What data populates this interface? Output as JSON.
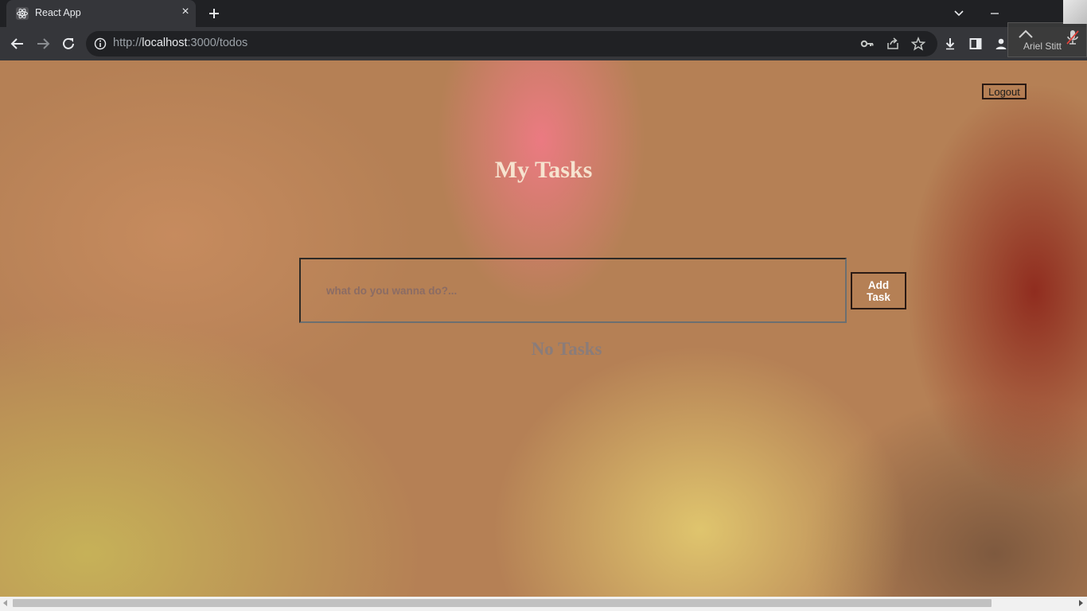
{
  "browser": {
    "tab": {
      "title": "React App",
      "close_glyph": "×"
    },
    "url": {
      "scheme": "http://",
      "host": "localhost",
      "rest": ":3000/todos"
    },
    "icons": [
      "react-favicon-icon",
      "close-icon",
      "plus-icon",
      "chevron-down-icon",
      "minimize-icon",
      "back-arrow-icon",
      "forward-arrow-icon",
      "reload-icon",
      "info-icon",
      "key-icon",
      "share-icon",
      "star-icon",
      "download-icon",
      "side-panel-icon",
      "profile-icon"
    ]
  },
  "meeting": {
    "participant_name": "Ariel Stitt"
  },
  "page": {
    "logout_label": "Logout",
    "title": "My Tasks",
    "input_placeholder": "what do you wanna do?...",
    "add_task_label": "Add Task",
    "empty_message": "No Tasks"
  },
  "colors": {
    "title": "#f6e3cf",
    "empty_message": "#8a7c7a",
    "border": "#2a1a14",
    "chrome_dark": "#202124",
    "chrome_toolbar": "#35363a"
  }
}
